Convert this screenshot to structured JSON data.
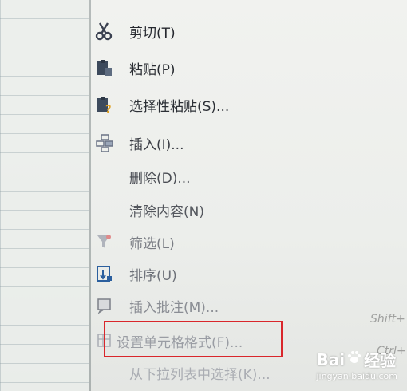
{
  "menu": {
    "items": [
      {
        "key": "cut",
        "label": "剪切(T)"
      },
      {
        "key": "paste",
        "label": "粘贴(P)"
      },
      {
        "key": "paste_special",
        "label": "选择性粘贴(S)..."
      },
      {
        "key": "insert",
        "label": "插入(I)..."
      },
      {
        "key": "delete",
        "label": "删除(D)..."
      },
      {
        "key": "clear",
        "label": "清除内容(N)"
      },
      {
        "key": "filter",
        "label": "筛选(L)"
      },
      {
        "key": "sort",
        "label": "排序(U)"
      },
      {
        "key": "insert_comment",
        "label": "插入批注(M)..."
      },
      {
        "key": "format_cells",
        "label": "设置单元格格式(F)..."
      },
      {
        "key": "pick_from_list",
        "label": "从下拉列表中选择(K)..."
      }
    ],
    "shortcuts": {
      "insert_comment": "Shift+",
      "format_cells": "Ctrl+"
    }
  },
  "watermark": {
    "brand": "Bai",
    "brand_suffix": "经验",
    "url": "jingyan.baidu.com"
  },
  "colors": {
    "highlight_border": "#d9262b",
    "menu_text": "#2a2d33",
    "icon_blue": "#2b5f9e"
  }
}
